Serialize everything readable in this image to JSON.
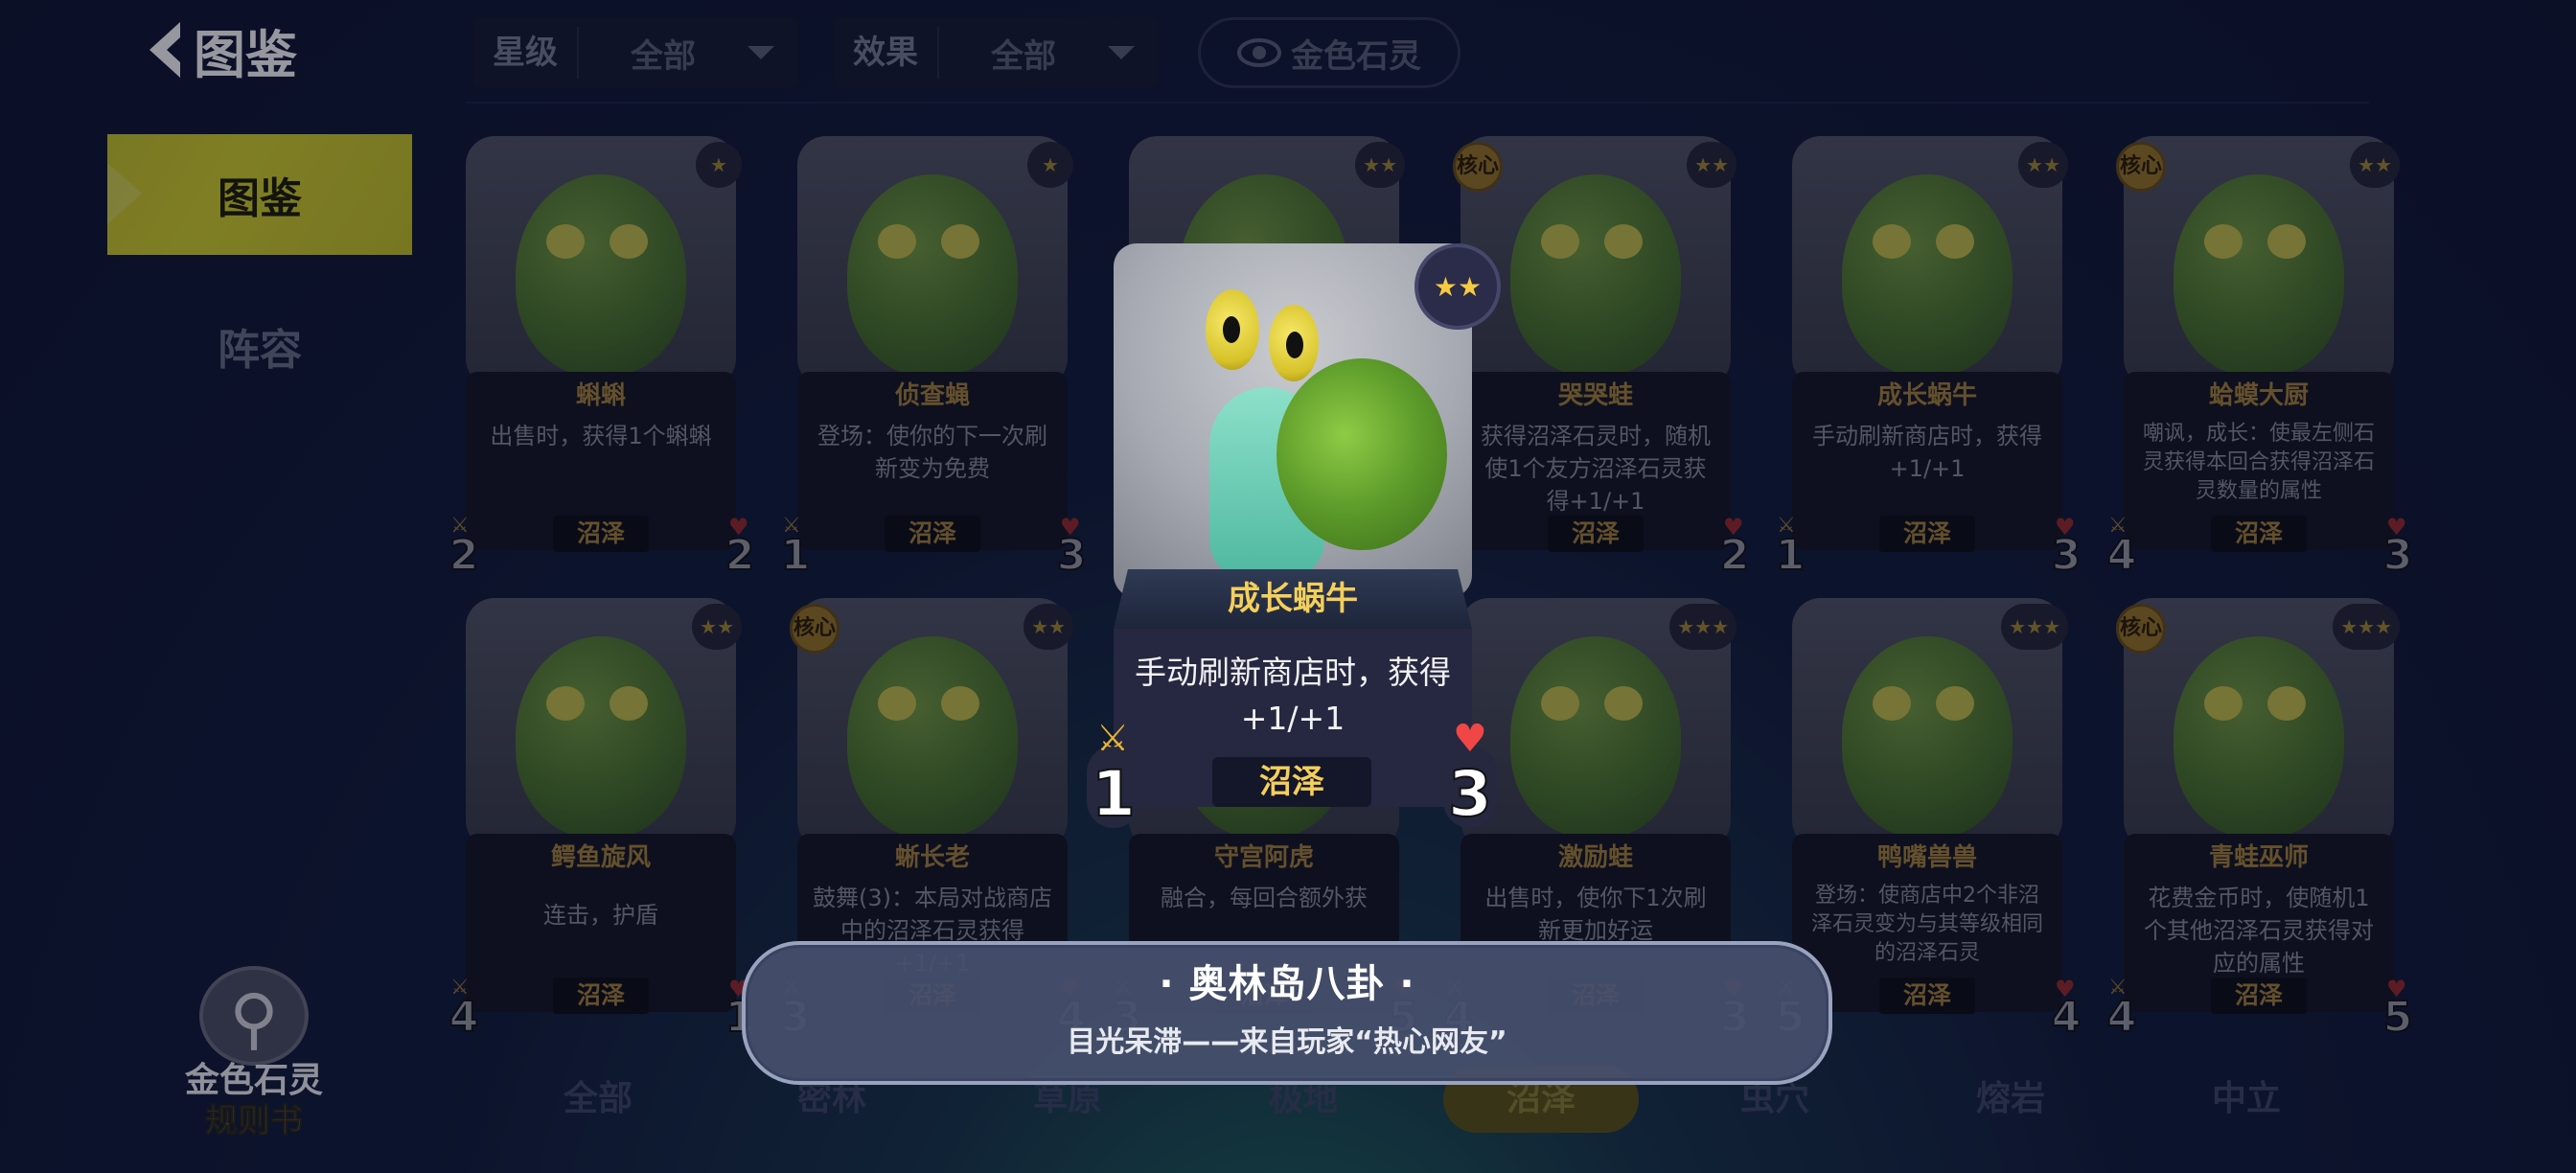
{
  "header": {
    "title": "图鉴",
    "filters": [
      {
        "label": "星级",
        "value": "全部"
      },
      {
        "label": "效果",
        "value": "全部"
      }
    ],
    "gold_toggle_label": "金色石灵"
  },
  "sidebar": {
    "items": [
      {
        "label": "图鉴",
        "active": true
      },
      {
        "label": "阵容",
        "active": false
      }
    ]
  },
  "cards": [
    {
      "name": "蝌蝌",
      "desc": "出售时，获得1个蝌蝌",
      "tribe": "沼泽",
      "atk": "2",
      "hp": "2",
      "stars": "★",
      "core": ""
    },
    {
      "name": "侦查蝇",
      "desc": "登场：使你的下一次刷新变为免费",
      "tribe": "沼泽",
      "atk": "1",
      "hp": "3",
      "stars": "★",
      "core": ""
    },
    {
      "name": "",
      "desc": "",
      "tribe": "",
      "atk": "",
      "hp": "",
      "stars": "★★",
      "core": ""
    },
    {
      "name": "哭哭蛙",
      "desc": "获得沼泽石灵时，随机使1个友方沼泽石灵获得+1/+1",
      "tribe": "沼泽",
      "atk": "",
      "hp": "2",
      "stars": "★★",
      "core": "核心"
    },
    {
      "name": "成长蜗牛",
      "desc": "手动刷新商店时，获得+1/+1",
      "tribe": "沼泽",
      "atk": "1",
      "hp": "3",
      "stars": "★★",
      "core": ""
    },
    {
      "name": "蛤蟆大厨",
      "desc": "嘲讽，成长：使最左侧石灵获得本回合获得沼泽石灵数量的属性",
      "tribe": "沼泽",
      "atk": "4",
      "hp": "3",
      "stars": "★★",
      "core": "核心"
    },
    {
      "name": "鳄鱼旋风",
      "desc": "连击，护盾",
      "tribe": "沼泽",
      "atk": "4",
      "hp": "1",
      "stars": "★★",
      "core": ""
    },
    {
      "name": "蜥长老",
      "desc": "鼓舞(3)：本局对战商店中的沼泽石灵获得+1/+1",
      "tribe": "沼泽",
      "atk": "3",
      "hp": "4",
      "stars": "★★",
      "core": "核心"
    },
    {
      "name": "守宫阿虎",
      "desc": "融合，每回合额外获",
      "tribe": "沼泽",
      "atk": "3",
      "hp": "5",
      "stars": "★★",
      "core": ""
    },
    {
      "name": "激励蛙",
      "desc": "出售时，使你下1次刷新更加好运",
      "tribe": "沼泽",
      "atk": "4",
      "hp": "3",
      "stars": "★★★",
      "core": ""
    },
    {
      "name": "鸭嘴兽兽",
      "desc": "登场：使商店中2个非沼泽石灵变为与其等级相同的沼泽石灵",
      "tribe": "沼泽",
      "atk": "5",
      "hp": "4",
      "stars": "★★★",
      "core": ""
    },
    {
      "name": "青蛙巫师",
      "desc": "花费金币时，使随机1个其他沼泽石灵获得对应的属性",
      "tribe": "沼泽",
      "atk": "4",
      "hp": "5",
      "stars": "★★★",
      "core": "核心"
    }
  ],
  "popup": {
    "stars": "★★",
    "name": "成长蜗牛",
    "desc": "手动刷新商店时，获得+1/+1",
    "tribe": "沼泽",
    "atk": "1",
    "hp": "3"
  },
  "gossip": {
    "title": "· 奥林岛八卦 ·",
    "text": "目光呆滞——来自玩家“热心网友”"
  },
  "tribes": [
    {
      "label": "全部",
      "active": false
    },
    {
      "label": "密林",
      "active": false
    },
    {
      "label": "草原",
      "active": false
    },
    {
      "label": "极地",
      "active": false
    },
    {
      "label": "沼泽",
      "active": true
    },
    {
      "label": "虫穴",
      "active": false
    },
    {
      "label": "熔岩",
      "active": false
    },
    {
      "label": "中立",
      "active": false
    }
  ],
  "rulebook": {
    "line1": "金色石灵",
    "line2": "规则书"
  },
  "colors": {
    "accent_yellow": "#d6d32c",
    "gold_text": "#f4cf5a",
    "heart_red": "#f04646"
  }
}
